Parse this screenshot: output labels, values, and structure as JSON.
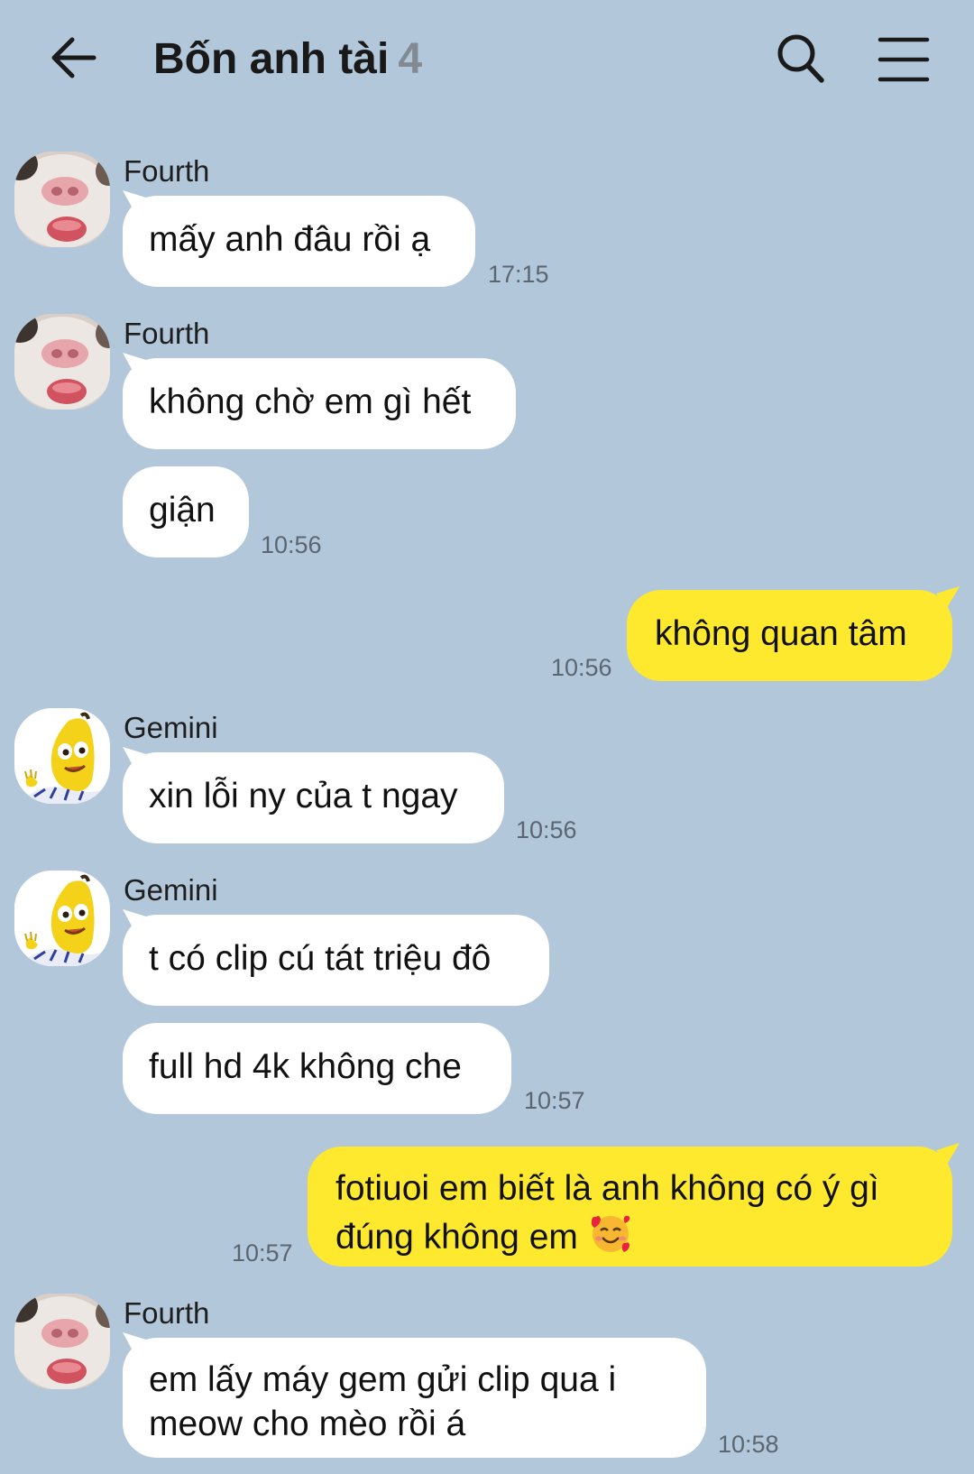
{
  "header": {
    "title": "Bốn anh tài",
    "member_count": "4"
  },
  "icons": {
    "back": "arrow-left-icon",
    "search": "search-icon",
    "menu": "hamburger-menu-icon"
  },
  "colors": {
    "background": "#b2c7da",
    "incoming_bubble": "#ffffff",
    "outgoing_bubble": "#fee92f",
    "timestamp": "#5b6672",
    "member_count": "#828a93"
  },
  "messages": [
    {
      "sender": "Fourth",
      "avatar": "hamster-avatar",
      "text": "mấy anh đâu rồi ạ",
      "time": "17:15"
    },
    {
      "sender": "Fourth",
      "avatar": "hamster-avatar",
      "text": "không chờ em gì hết"
    },
    {
      "text": "giận",
      "time": "10:56"
    },
    {
      "direction": "outgoing",
      "text": "không quan tâm",
      "time": "10:56"
    },
    {
      "sender": "Gemini",
      "avatar": "banana-avatar",
      "text": "xin lỗi ny của t ngay",
      "time": "10:56"
    },
    {
      "sender": "Gemini",
      "avatar": "banana-avatar",
      "text": "t có clip cú tát triệu đô"
    },
    {
      "text": "full hd 4k không che",
      "time": "10:57"
    },
    {
      "direction": "outgoing",
      "lines": [
        "fotiuoi em biết là anh không có ý gì",
        "đúng không em"
      ],
      "emoji": "smiling-face-with-hearts-icon",
      "time": "10:57"
    },
    {
      "sender": "Fourth",
      "avatar": "hamster-avatar",
      "lines": [
        "em lấy máy gem gửi clip qua i",
        "meow cho mèo rồi á"
      ],
      "time": "10:58"
    }
  ]
}
